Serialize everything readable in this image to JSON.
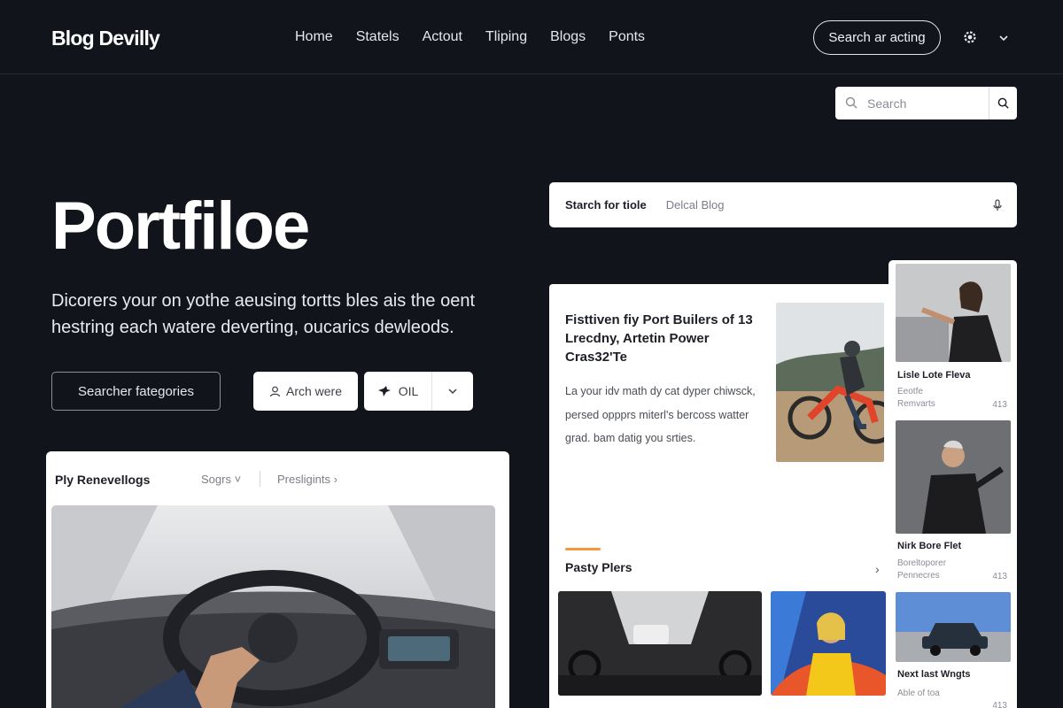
{
  "header": {
    "logo": "Blog Devilly",
    "nav": [
      "Home",
      "Statels",
      "Actout",
      "Tliping",
      "Blogs",
      "Ponts"
    ],
    "cta_label": "Search ar acting",
    "search_placeholder": "Search"
  },
  "hero": {
    "title": "Portfiloe",
    "subtitle": "Dicorers your on yothe aeusing tortts bles ais the oent hestring each watere deverting, oucarics dewleods.",
    "category_button": "Searcher fategories",
    "arch_button": "Arch were",
    "oil_button": "OIL"
  },
  "left_card": {
    "title": "Ply Renevellogs",
    "filter1": "Sogrs",
    "filter2": "Presligints"
  },
  "search_bar": {
    "label": "Starch for tiole",
    "value": "Delcal Blog"
  },
  "feature": {
    "title": "Fisttiven fiy Port Builers of 13 Lrecdny, Artetin Power Cras32'Te",
    "description": "La your idv math dy cat dyper chiwsck, persed oppprs miterl's bercoss watter grad. bam datig you srties.",
    "section_title": "Pasty Plers",
    "section_arrow": "›"
  },
  "side_list": [
    {
      "name": "Lisle Lote Fleva",
      "meta1": "Eeotfe",
      "meta2": "Remvarts",
      "count": "413"
    },
    {
      "name": "Nirk Bore Flet",
      "meta1": "Boreltoporer",
      "meta2": "Pennecres",
      "count": "413"
    },
    {
      "name": "Next last Wngts",
      "meta1": "Able of toa",
      "meta2": "",
      "count": "413"
    }
  ],
  "colors": {
    "background": "#12141c",
    "accent": "#f29a3a",
    "card": "#ffffff"
  },
  "icons": [
    "gear-icon",
    "chevron-down-icon",
    "search-icon",
    "mic-icon",
    "user-icon",
    "bird-icon",
    "arrow-right-icon"
  ]
}
